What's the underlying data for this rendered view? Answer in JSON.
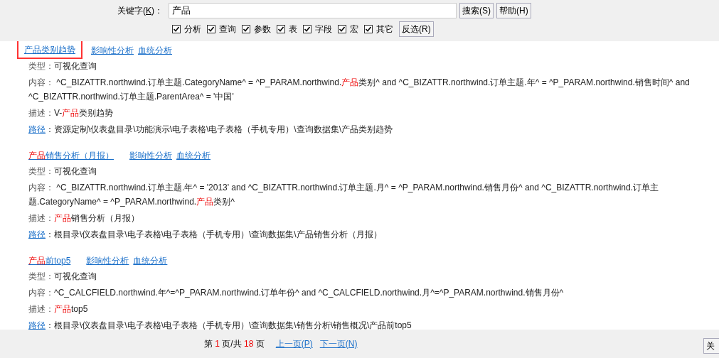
{
  "search": {
    "label_parts": [
      {
        "text": "关键字(",
        "underline": false
      },
      {
        "text": "K",
        "underline": true
      },
      {
        "text": ")：",
        "underline": false
      }
    ],
    "value": "产品",
    "buttons": [
      "搜索(S)",
      "帮助(H)"
    ]
  },
  "filters": [
    {
      "label": "分析",
      "checked": true
    },
    {
      "label": "查询",
      "checked": true
    },
    {
      "label": "参数",
      "checked": true
    },
    {
      "label": "表",
      "checked": true
    },
    {
      "label": "字段",
      "checked": true
    },
    {
      "label": "宏",
      "checked": true
    },
    {
      "label": "其它",
      "checked": true
    }
  ],
  "invert_button": "反选(R)",
  "results": [
    {
      "title": [
        {
          "text": "产品类别趋势",
          "highlight": false
        }
      ],
      "framed": true,
      "links": [
        "影响性分析",
        "血统分析"
      ],
      "fields": [
        {
          "kind": "text",
          "label": "类型：",
          "value": [
            {
              "text": "可视化查询",
              "highlight": false
            }
          ]
        },
        {
          "kind": "text",
          "label": "内容：",
          "value": [
            {
              "text": " ^C_BIZATTR.northwind.订单主题.CategoryName^ = ^P_PARAM.northwind.",
              "highlight": false
            },
            {
              "text": "产品",
              "highlight": true
            },
            {
              "text": "类别^ and ^C_BIZATTR.northwind.订单主题.年^ = ^P_PARAM.northwind.销售时间^ and ^C_BIZATTR.northwind.订单主题.ParentArea^ = '中国'",
              "highlight": false
            }
          ]
        },
        {
          "kind": "text",
          "label": "描述：",
          "value": [
            {
              "text": "V-",
              "highlight": false
            },
            {
              "text": "产品",
              "highlight": true
            },
            {
              "text": "类别趋势",
              "highlight": false
            }
          ]
        },
        {
          "kind": "link",
          "label": "路径",
          "value": [
            {
              "text": "：资源定制\\仪表盘目录\\功能演示\\电子表格\\电子表格（手机专用）\\查询数据集\\产品类别趋势",
              "highlight": false
            }
          ]
        }
      ]
    },
    {
      "title": [
        {
          "text": "产品",
          "highlight": true
        },
        {
          "text": "销售分析（月报）",
          "highlight": false
        }
      ],
      "framed": false,
      "links": [
        "影响性分析",
        "血统分析"
      ],
      "fields": [
        {
          "kind": "text",
          "label": "类型：",
          "value": [
            {
              "text": "可视化查询",
              "highlight": false
            }
          ]
        },
        {
          "kind": "text",
          "label": "内容：",
          "value": [
            {
              "text": " ^C_BIZATTR.northwind.订单主题.年^ = '2013' and ^C_BIZATTR.northwind.订单主题.月^ = ^P_PARAM.northwind.销售月份^ and ^C_BIZATTR.northwind.订单主题.CategoryName^ = ^P_PARAM.northwind.",
              "highlight": false
            },
            {
              "text": "产品",
              "highlight": true
            },
            {
              "text": "类别^",
              "highlight": false
            }
          ]
        },
        {
          "kind": "text",
          "label": "描述：",
          "value": [
            {
              "text": "产品",
              "highlight": true
            },
            {
              "text": "销售分析（月报）",
              "highlight": false
            }
          ]
        },
        {
          "kind": "link",
          "label": "路径",
          "value": [
            {
              "text": "：根目录\\仪表盘目录\\电子表格\\电子表格（手机专用）\\查询数据集\\产品销售分析（月报）",
              "highlight": false
            }
          ]
        }
      ]
    },
    {
      "title": [
        {
          "text": "产品",
          "highlight": true
        },
        {
          "text": "前top5",
          "highlight": false
        }
      ],
      "framed": false,
      "links": [
        "影响性分析",
        "血统分析"
      ],
      "fields": [
        {
          "kind": "text",
          "label": "类型：",
          "value": [
            {
              "text": "可视化查询",
              "highlight": false
            }
          ]
        },
        {
          "kind": "text",
          "label": "内容：",
          "value": [
            {
              "text": "^C_CALCFIELD.northwind.年^=^P_PARAM.northwind.订单年份^ and ^C_CALCFIELD.northwind.月^=^P_PARAM.northwind.销售月份^",
              "highlight": false
            }
          ]
        },
        {
          "kind": "text",
          "label": "描述：",
          "value": [
            {
              "text": "产品",
              "highlight": true
            },
            {
              "text": "top5",
              "highlight": false
            }
          ]
        },
        {
          "kind": "link",
          "label": "路径",
          "value": [
            {
              "text": "：根目录\\仪表盘目录\\电子表格\\电子表格（手机专用）\\查询数据集\\销售分析\\销售概况\\产品前top5",
              "highlight": false
            }
          ]
        }
      ]
    }
  ],
  "pager": {
    "status": [
      {
        "text": "第 ",
        "highlight": false
      },
      {
        "text": "1",
        "highlight": true
      },
      {
        "text": " 页/共 ",
        "highlight": false
      },
      {
        "text": "18",
        "highlight": true
      },
      {
        "text": " 页",
        "highlight": false
      }
    ],
    "links": [
      "上一页(P)",
      "下一页(N)"
    ]
  },
  "close_button": "关"
}
